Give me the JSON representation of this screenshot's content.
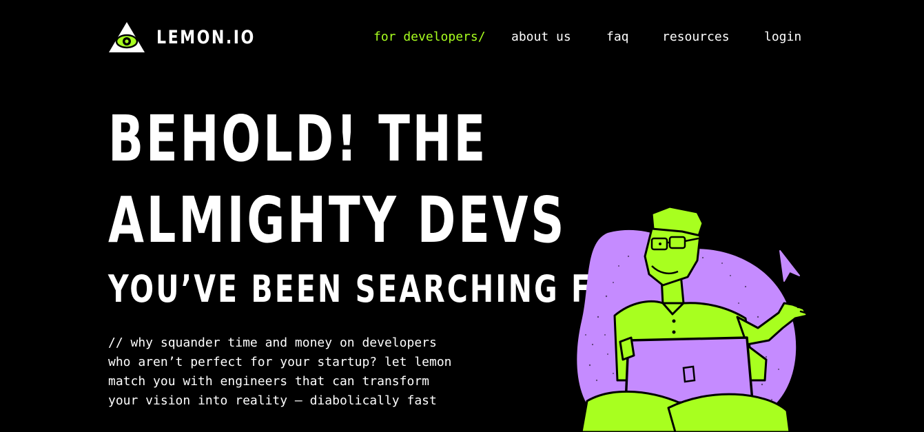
{
  "brand": {
    "name": "LEMON.IO",
    "accent_color": "#a8ff1f",
    "secondary_color": "#c58bff",
    "background_color": "#000000"
  },
  "nav": {
    "items": [
      {
        "label": "for developers/",
        "active": true
      },
      {
        "label": "about us",
        "active": false
      },
      {
        "label": "faq",
        "active": false
      },
      {
        "label": "resources",
        "active": false
      },
      {
        "label": "login",
        "active": false
      }
    ]
  },
  "hero": {
    "headline_line1": "BEHOLD! THE",
    "headline_line2": "ALMIGHTY DEVS",
    "subheadline": "YOU’VE BEEN SEARCHING FOR",
    "intro_lines": [
      "// why squander time and money on developers",
      "who aren’t perfect for your startup? let lemon",
      "match you with engineers that can transform",
      "your vision into reality — diabolically fast"
    ]
  },
  "icons": {
    "logo": "eye-in-triangle-icon",
    "cursor": "mouse-pointer-icon",
    "illustration": "developer-with-laptop-illustration"
  }
}
